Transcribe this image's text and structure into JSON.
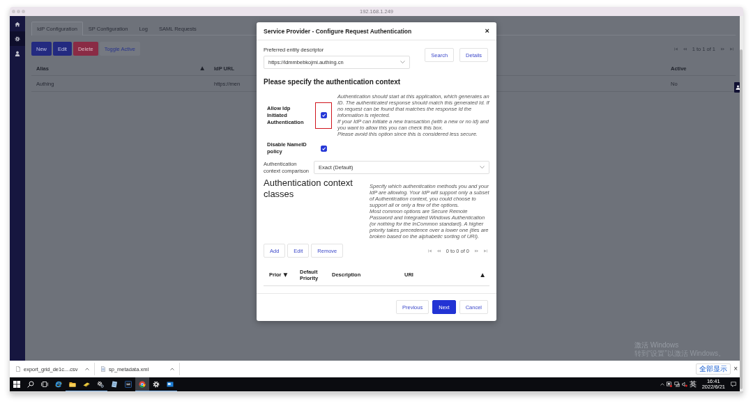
{
  "browser": {
    "title": "192.168.1.249"
  },
  "sidebar": {
    "items": [
      {
        "kind": "home",
        "selected": false
      },
      {
        "kind": "settings",
        "selected": true
      },
      {
        "kind": "user",
        "selected": false
      }
    ]
  },
  "tabs": [
    {
      "label": "IdP Configuration",
      "selected": true
    },
    {
      "label": "SP Configuration",
      "selected": false
    },
    {
      "label": "Log",
      "selected": false
    },
    {
      "label": "SAML Requests",
      "selected": false
    }
  ],
  "toolbar": {
    "buttons": [
      {
        "label": "New",
        "kind": "primary"
      },
      {
        "label": "Edit",
        "kind": "primary"
      },
      {
        "label": "Delete",
        "kind": "danger"
      },
      {
        "label": "Toggle Active",
        "kind": "plain"
      }
    ],
    "pager": "1 to 1 of 1"
  },
  "table": {
    "columns": [
      {
        "label": "Alias",
        "sort_mark": "▲"
      },
      {
        "label": "IdP URL"
      },
      {
        "label": "Active"
      }
    ],
    "rows": [
      {
        "cells": [
          "Authing",
          "https://men",
          "No"
        ]
      }
    ]
  },
  "modal": {
    "title": "Service Provider - Configure Request Authentication",
    "close": "×",
    "entity": {
      "label": "Preferred entity descriptor",
      "value": "https://ldmmbebkojmi.authing.cn"
    },
    "entity_buttons": [
      "Search",
      "Details"
    ],
    "heading": "Please specify the authentication context",
    "options": [
      {
        "label": "Allow Idp Initiated Authentication",
        "checked": true,
        "highlighted": true,
        "description": [
          "Authentication should start at this application, which generates an ID. The authenticated response should match this generated Id. If no request can be found that matches the response Id the information is rejected.",
          "If your IdP can initiate a new transaction (with a new or no id) and you want to allow this you can check this box.",
          "Please avoid this option since this is considered less secure."
        ]
      },
      {
        "label": "Disable NameID policy",
        "checked": true,
        "highlighted": false
      }
    ],
    "comparison": {
      "label": "Authentication context comparison",
      "value": "Exact (Default)"
    },
    "classes": {
      "heading": "Authentication context classes",
      "description": [
        "Specify which authentication methods you and your IdP are allowing. Your IdP will support only a subset of Authentication context, you could choose to support all or only a few of the options.",
        "Most common options are Secure Remote Password and Integrated Windows Authentication (or nothing for the InCommon standard). A higher priority takes precedence over a lower one (ties are broken based on the alphabetic sorting of URI)."
      ],
      "buttons": [
        "Add",
        "Edit",
        "Remove"
      ],
      "pager": "0 to 0 of 0",
      "columns": [
        {
          "label": "Prior",
          "sort_mark": "▼"
        },
        {
          "label": "Default Priority"
        },
        {
          "label": "Description"
        },
        {
          "label": "URI",
          "sort_mark": "▲"
        }
      ]
    },
    "footer_buttons": [
      {
        "label": "Previous",
        "kind": "plain"
      },
      {
        "label": "Next",
        "kind": "primary"
      },
      {
        "label": "Cancel",
        "kind": "plain"
      }
    ]
  },
  "activation_notice": {
    "title": "激活 Windows",
    "hint": "转到“设置”以激活 Windows。"
  },
  "downloads": {
    "items": [
      {
        "name": "export_grid_de1c....csv",
        "kind": "file"
      },
      {
        "name": "sp_metadata.xml",
        "kind": "xml"
      }
    ],
    "show_all": "全部显示",
    "close": "×"
  },
  "taskbar": {
    "apps": [
      {
        "kind": "ie",
        "running": false,
        "selected": false
      },
      {
        "kind": "explorer",
        "running": true,
        "selected": false
      },
      {
        "kind": "tool",
        "running": true,
        "selected": false
      },
      {
        "kind": "services",
        "running": true,
        "selected": false
      },
      {
        "kind": "notepad",
        "running": false,
        "selected": false
      },
      {
        "kind": "terminal",
        "running": false,
        "selected": false
      },
      {
        "kind": "chrome",
        "running": true,
        "selected": true
      },
      {
        "kind": "settings",
        "running": true,
        "selected": false
      },
      {
        "kind": "remote",
        "running": true,
        "selected": false
      }
    ],
    "tray": {
      "language": "英",
      "time": "16:41",
      "date": "2022/6/21"
    }
  }
}
